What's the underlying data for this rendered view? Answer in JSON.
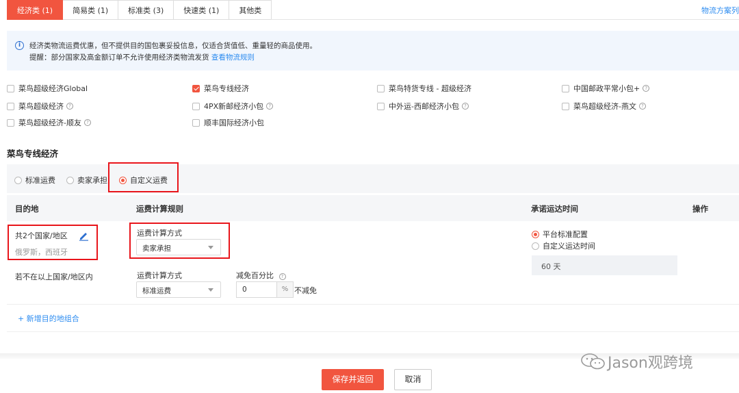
{
  "tabs": [
    {
      "label": "经济类 (1)",
      "active": true
    },
    {
      "label": "简易类 (1)",
      "active": false
    },
    {
      "label": "标准类 (3)",
      "active": false
    },
    {
      "label": "快速类 (1)",
      "active": false
    },
    {
      "label": "其他类",
      "active": false
    }
  ],
  "top_link": "物流方案列",
  "info": {
    "line1": "经济类物流运费优惠，但不提供目的国包裹妥投信息，仅适合货值低、重量轻的商品使用。",
    "line2": "提醒：部分国家及高金额订单不允许使用经济类物流发货",
    "link": "查看物流规则"
  },
  "carriers": [
    {
      "label": "菜鸟超级经济Global",
      "checked": false,
      "help": false
    },
    {
      "label": "菜鸟专线经济",
      "checked": true,
      "help": false
    },
    {
      "label": "菜鸟特货专线 - 超级经济",
      "checked": false,
      "help": false
    },
    {
      "label": "中国邮政平常小包+",
      "checked": false,
      "help": true
    },
    {
      "label": "菜鸟超级经济",
      "checked": false,
      "help": true
    },
    {
      "label": "4PX新邮经济小包",
      "checked": false,
      "help": true
    },
    {
      "label": "中外运-西邮经济小包",
      "checked": false,
      "help": true
    },
    {
      "label": "菜鸟超级经济-燕文",
      "checked": false,
      "help": true
    },
    {
      "label": "菜鸟超级经济-顺友",
      "checked": false,
      "help": true
    },
    {
      "label": "顺丰国际经济小包",
      "checked": false,
      "help": false
    }
  ],
  "section_title": "菜鸟专线经济",
  "fee_options": [
    {
      "label": "标准运费",
      "selected": false
    },
    {
      "label": "卖家承担",
      "selected": false
    },
    {
      "label": "自定义运费",
      "selected": true
    }
  ],
  "table": {
    "headers": {
      "dest": "目的地",
      "rule": "运费计算规则",
      "time": "承诺运达时间",
      "ops": "操作"
    },
    "row1": {
      "dest_title": "共2个国家/地区",
      "dest_countries": "俄罗斯，西班牙",
      "calc_label": "运费计算方式",
      "calc_value": "卖家承担"
    },
    "row2": {
      "dest_title": "若不在以上国家/地区内",
      "calc_label": "运费计算方式",
      "calc_value": "标准运费",
      "discount_label": "减免百分比",
      "discount_value": "0",
      "discount_unit": "%",
      "discount_note": "不减免"
    },
    "delivery": {
      "options": [
        {
          "label": "平台标准配置",
          "selected": true
        },
        {
          "label": "自定义运达时间",
          "selected": false
        }
      ],
      "days": "60 天"
    }
  },
  "add_link": "+ 新增目的地组合",
  "buttons": {
    "save": "保存并返回",
    "cancel": "取消"
  },
  "watermark": "Jason观跨境",
  "colors": {
    "accent": "#f1553f",
    "link": "#2d8cf0",
    "highlight": "#e8141a"
  }
}
